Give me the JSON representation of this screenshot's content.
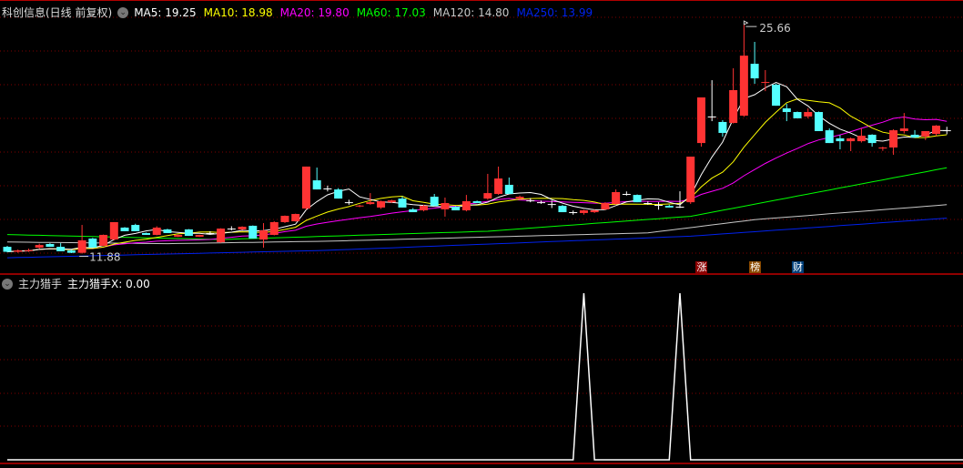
{
  "header": {
    "title": "科创信息(日线 前复权)",
    "ma_labels": [
      {
        "text": "MA5: 19.25",
        "color": "#ffffff"
      },
      {
        "text": "MA10: 18.98",
        "color": "#ffff00"
      },
      {
        "text": "MA20: 19.80",
        "color": "#ff00ff"
      },
      {
        "text": "MA60: 17.03",
        "color": "#00ff00"
      },
      {
        "text": "MA120: 14.80",
        "color": "#c8c8c8"
      },
      {
        "text": "MA250: 13.99",
        "color": "#0022ee"
      }
    ]
  },
  "price_panel": {
    "max_label": "25.66",
    "min_label": "11.88",
    "tags": [
      {
        "text": "涨",
        "bg": "#8b0000",
        "index": 65
      },
      {
        "text": "榜",
        "bg": "#8a4a00",
        "index": 70
      },
      {
        "text": "财",
        "bg": "#00407a",
        "index": 74
      }
    ]
  },
  "indicator_panel": {
    "name": "主力猎手",
    "value_label": "主力猎手X: 0.00"
  },
  "chart_data": {
    "type": "candlestick",
    "candles_ohlc": [
      [
        12.26,
        12.32,
        11.93,
        11.96
      ],
      [
        11.96,
        12.1,
        11.9,
        12.04
      ],
      [
        12.0,
        12.15,
        11.95,
        12.06
      ],
      [
        12.21,
        12.45,
        12.15,
        12.37
      ],
      [
        12.43,
        12.48,
        12.26,
        12.26
      ],
      [
        12.26,
        12.48,
        11.99,
        11.99
      ],
      [
        12.04,
        12.1,
        11.88,
        11.9
      ],
      [
        11.9,
        13.58,
        11.85,
        12.65
      ],
      [
        12.76,
        12.8,
        12.21,
        12.21
      ],
      [
        12.32,
        13.0,
        12.3,
        12.98
      ],
      [
        12.7,
        13.75,
        12.65,
        13.75
      ],
      [
        13.42,
        13.45,
        13.2,
        13.2
      ],
      [
        13.58,
        13.65,
        13.2,
        13.2
      ],
      [
        13.09,
        13.12,
        12.98,
        12.98
      ],
      [
        12.98,
        13.5,
        12.95,
        13.42
      ],
      [
        13.31,
        13.35,
        13.09,
        13.09
      ],
      [
        12.87,
        13.0,
        12.85,
        12.98
      ],
      [
        13.31,
        13.33,
        12.92,
        12.92
      ],
      [
        12.87,
        12.99,
        12.85,
        12.98
      ],
      [
        13.09,
        13.2,
        13.0,
        13.09
      ],
      [
        12.54,
        13.38,
        12.5,
        13.36
      ],
      [
        13.36,
        13.5,
        13.25,
        13.36
      ],
      [
        13.31,
        13.5,
        13.28,
        13.47
      ],
      [
        13.53,
        13.55,
        12.76,
        12.76
      ],
      [
        12.7,
        13.69,
        12.21,
        13.25
      ],
      [
        12.98,
        13.8,
        12.95,
        13.75
      ],
      [
        13.75,
        14.15,
        13.7,
        14.13
      ],
      [
        13.8,
        14.26,
        13.78,
        14.24
      ],
      [
        14.57,
        17.1,
        14.5,
        17.1
      ],
      [
        16.27,
        17.04,
        15.72,
        15.72
      ],
      [
        15.78,
        15.95,
        15.6,
        15.78
      ],
      [
        15.72,
        15.8,
        15.17,
        15.17
      ],
      [
        14.95,
        15.1,
        14.8,
        14.95
      ],
      [
        14.7,
        14.8,
        14.65,
        14.75
      ],
      [
        14.84,
        15.5,
        14.8,
        14.95
      ],
      [
        14.63,
        15.05,
        14.55,
        15.01
      ],
      [
        14.95,
        15.1,
        14.9,
        15.06
      ],
      [
        15.17,
        15.3,
        14.63,
        14.63
      ],
      [
        14.52,
        14.6,
        14.35,
        14.35
      ],
      [
        14.46,
        14.8,
        14.4,
        14.73
      ],
      [
        15.28,
        15.45,
        14.73,
        14.73
      ],
      [
        14.52,
        15.23,
        14.08,
        14.9
      ],
      [
        14.68,
        14.72,
        14.46,
        14.46
      ],
      [
        14.46,
        15.39,
        14.4,
        15.01
      ],
      [
        15.01,
        15.05,
        14.9,
        14.9
      ],
      [
        15.17,
        16.66,
        15.1,
        15.5
      ],
      [
        15.45,
        17.1,
        15.4,
        16.38
      ],
      [
        16.0,
        16.44,
        15.45,
        15.45
      ],
      [
        15.17,
        15.35,
        15.1,
        15.28
      ],
      [
        15.06,
        15.2,
        14.95,
        15.06
      ],
      [
        14.95,
        15.05,
        14.85,
        14.95
      ],
      [
        14.84,
        15.05,
        14.6,
        14.84
      ],
      [
        14.73,
        14.78,
        14.35,
        14.35
      ],
      [
        14.35,
        14.45,
        14.2,
        14.35
      ],
      [
        14.3,
        14.5,
        14.2,
        14.46
      ],
      [
        14.35,
        14.5,
        14.3,
        14.46
      ],
      [
        14.52,
        14.95,
        14.48,
        14.9
      ],
      [
        14.84,
        15.72,
        14.8,
        15.56
      ],
      [
        15.45,
        15.6,
        15.35,
        15.45
      ],
      [
        15.39,
        15.42,
        14.95,
        14.95
      ],
      [
        14.9,
        15.0,
        14.8,
        14.9
      ],
      [
        14.79,
        14.95,
        14.5,
        14.79
      ],
      [
        14.73,
        14.8,
        14.63,
        14.63
      ],
      [
        14.68,
        15.61,
        14.6,
        14.68
      ],
      [
        14.95,
        17.7,
        14.85,
        17.7
      ],
      [
        18.52,
        21.27,
        18.3,
        21.27
      ],
      [
        20.12,
        22.31,
        19.84,
        20.12
      ],
      [
        19.79,
        19.9,
        18.9,
        19.13
      ],
      [
        19.73,
        23.03,
        19.7,
        21.71
      ],
      [
        20.17,
        25.66,
        20.1,
        23.79
      ],
      [
        23.3,
        24.62,
        22.09,
        22.42
      ],
      [
        22.15,
        22.92,
        21.65,
        22.2
      ],
      [
        22.04,
        22.1,
        20.77,
        20.77
      ],
      [
        20.61,
        20.88,
        19.84,
        20.39
      ],
      [
        20.39,
        20.42,
        20.01,
        20.01
      ],
      [
        20.12,
        20.61,
        20.01,
        20.39
      ],
      [
        20.39,
        20.42,
        19.24,
        19.24
      ],
      [
        19.29,
        19.4,
        18.52,
        18.52
      ],
      [
        18.8,
        19.0,
        18.14,
        18.63
      ],
      [
        18.63,
        18.85,
        18.03,
        18.8
      ],
      [
        18.63,
        19.4,
        18.55,
        18.96
      ],
      [
        19.02,
        19.05,
        18.3,
        18.52
      ],
      [
        18.19,
        18.3,
        18.05,
        18.25
      ],
      [
        18.25,
        19.35,
        17.81,
        19.29
      ],
      [
        19.24,
        20.33,
        19.1,
        19.4
      ],
      [
        19.02,
        19.3,
        18.85,
        18.85
      ],
      [
        18.91,
        19.1,
        18.7,
        19.24
      ],
      [
        19.07,
        19.6,
        18.95,
        19.57
      ],
      [
        19.29,
        19.5,
        19.05,
        19.29
      ]
    ],
    "long_ma_anchors": {
      "MA60": [
        [
          0,
          13.0
        ],
        [
          20,
          12.7
        ],
        [
          45,
          13.2
        ],
        [
          64,
          14.1
        ],
        [
          88,
          17.03
        ]
      ],
      "MA120": [
        [
          0,
          12.55
        ],
        [
          15,
          12.45
        ],
        [
          30,
          12.6
        ],
        [
          60,
          13.1
        ],
        [
          70,
          13.9
        ],
        [
          88,
          14.8
        ]
      ],
      "MA250": [
        [
          0,
          11.6
        ],
        [
          30,
          12.05
        ],
        [
          64,
          12.9
        ],
        [
          88,
          13.99
        ]
      ]
    },
    "indicator_values_nonzero": {
      "54": 1,
      "63": 1
    },
    "price_range": [
      11.88,
      25.66
    ]
  }
}
